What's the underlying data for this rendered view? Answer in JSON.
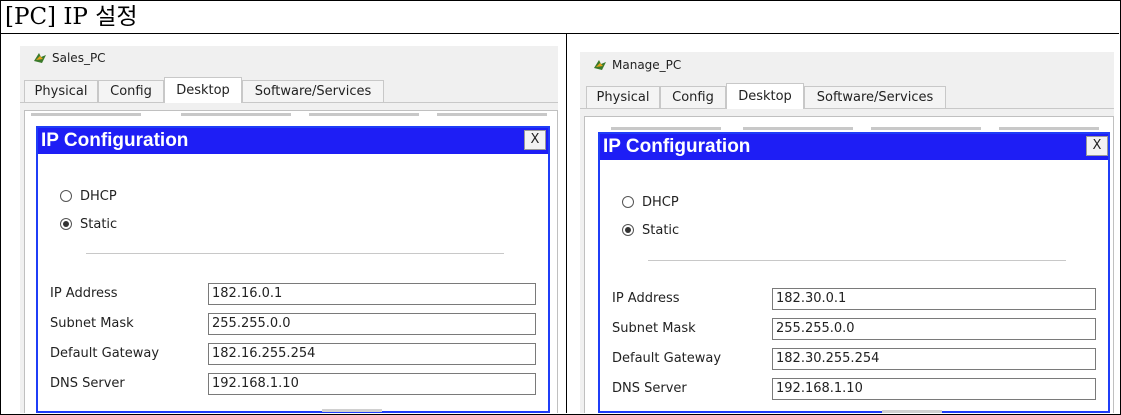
{
  "document": {
    "title": "[PC] IP 설정"
  },
  "colors": {
    "header_blue": "#1e1ef5",
    "frame_blue": "#1f3df7"
  },
  "left_pc": {
    "window_title": "Sales_PC",
    "tabs": [
      {
        "label": "Physical"
      },
      {
        "label": "Config"
      },
      {
        "label": "Desktop",
        "active": true
      },
      {
        "label": "Software/Services"
      }
    ],
    "dialog": {
      "title": "IP Configuration",
      "close_label": "X",
      "dhcp_label": "DHCP",
      "static_label": "Static",
      "selected_mode": "Static",
      "fields": [
        {
          "label": "IP Address",
          "value": "182.16.0.1"
        },
        {
          "label": "Subnet Mask",
          "value": "255.255.0.0"
        },
        {
          "label": "Default Gateway",
          "value": "182.16.255.254"
        },
        {
          "label": "DNS Server",
          "value": "192.168.1.10"
        }
      ]
    }
  },
  "right_pc": {
    "window_title": "Manage_PC",
    "tabs": [
      {
        "label": "Physical"
      },
      {
        "label": "Config"
      },
      {
        "label": "Desktop",
        "active": true
      },
      {
        "label": "Software/Services"
      }
    ],
    "dialog": {
      "title": "IP Configuration",
      "close_label": "X",
      "dhcp_label": "DHCP",
      "static_label": "Static",
      "selected_mode": "Static",
      "fields": [
        {
          "label": "IP Address",
          "value": "182.30.0.1"
        },
        {
          "label": "Subnet Mask",
          "value": "255.255.0.0"
        },
        {
          "label": "Default Gateway",
          "value": "182.30.255.254"
        },
        {
          "label": "DNS Server",
          "value": "192.168.1.10"
        }
      ]
    }
  }
}
